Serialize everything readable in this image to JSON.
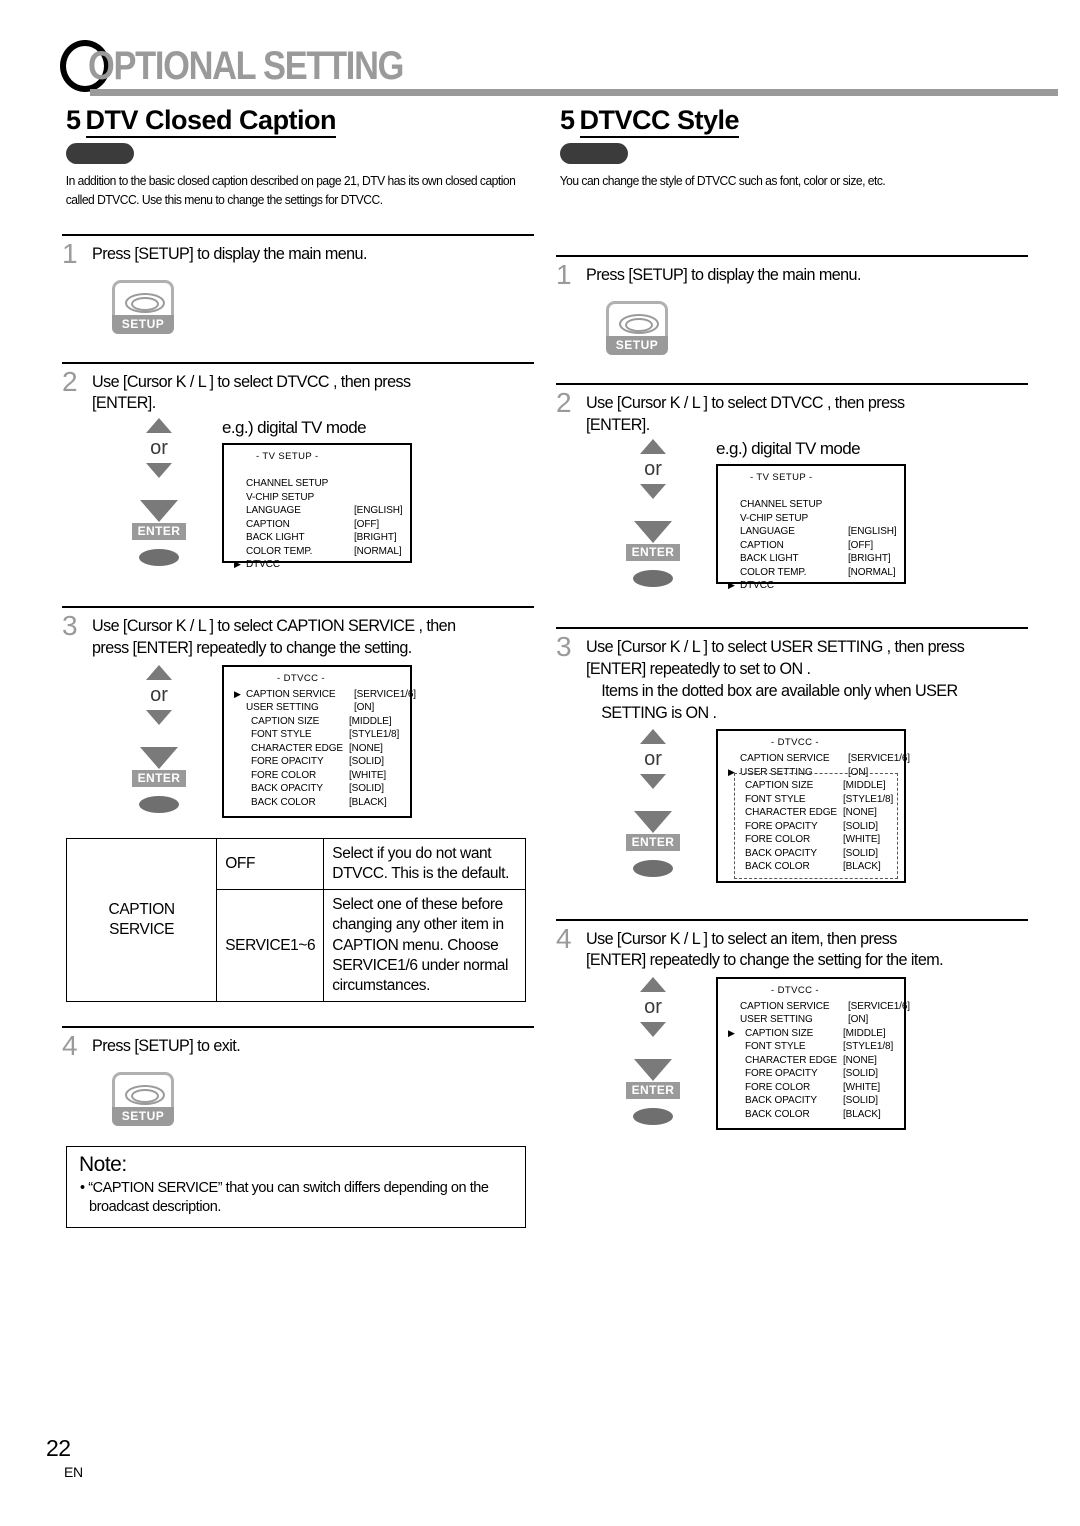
{
  "page": {
    "header_title": "OPTIONAL SETTING",
    "footer_number": "22",
    "footer_lang": "EN"
  },
  "columns": {
    "left": {
      "section_number": "5",
      "section_title": "DTV Closed Caption",
      "description": "In addition to the basic closed caption described on page 21, DTV has its own closed caption called DTVCC. Use this menu to change the settings for DTVCC.",
      "steps": {
        "s1": {
          "num": "1",
          "text": "Press [SETUP] to display the main menu."
        },
        "s2": {
          "num": "2",
          "line1": "Use [Cursor K / L ] to select  DTVCC , then press",
          "line2": "[ENTER].",
          "eg_label": "e.g.) digital TV mode"
        },
        "s3": {
          "num": "3",
          "line1": "Use [Cursor K / L ] to select  CAPTION SERVICE , then",
          "line2": "press [ENTER] repeatedly to change the setting."
        },
        "s4": {
          "num": "4",
          "text": "Press [SETUP] to exit."
        }
      },
      "keypad": {
        "or": "or",
        "enter": "ENTER"
      },
      "setup_key_label": "SETUP",
      "osd_tv_setup": {
        "title": "-  TV SETUP  -",
        "rows": [
          {
            "caret": "",
            "label": "CHANNEL SETUP",
            "value": ""
          },
          {
            "caret": "",
            "label": "V-CHIP  SETUP",
            "value": ""
          },
          {
            "caret": "",
            "label": "LANGUAGE",
            "value": "[ENGLISH]"
          },
          {
            "caret": "",
            "label": "CAPTION",
            "value": "[OFF]"
          },
          {
            "caret": "",
            "label": "BACK  LIGHT",
            "value": "[BRIGHT]"
          },
          {
            "caret": "",
            "label": "COLOR  TEMP.",
            "value": "[NORMAL]"
          },
          {
            "caret": "▶",
            "label": "DTVCC",
            "value": ""
          }
        ]
      },
      "osd_dtvcc": {
        "title": "- DTVCC -",
        "rows": [
          {
            "caret": "▶",
            "label": "CAPTION SERVICE",
            "value": "[SERVICE1/6]"
          },
          {
            "caret": "",
            "label": "USER SETTING",
            "value": "[ON]"
          },
          {
            "caret": "",
            "label": "CAPTION SIZE",
            "value": "[MIDDLE]"
          },
          {
            "caret": "",
            "label": "FONT STYLE",
            "value": "[STYLE1/8]"
          },
          {
            "caret": "",
            "label": "CHARACTER EDGE",
            "value": "[NONE]"
          },
          {
            "caret": "",
            "label": "FORE OPACITY",
            "value": "[SOLID]"
          },
          {
            "caret": "",
            "label": "FORE COLOR",
            "value": "[WHITE]"
          },
          {
            "caret": "",
            "label": "BACK OPACITY",
            "value": "[SOLID]"
          },
          {
            "caret": "",
            "label": "BACK COLOR",
            "value": "[BLACK]"
          }
        ]
      },
      "table": {
        "name": "CAPTION SERVICE",
        "rows": [
          {
            "value": "OFF",
            "desc": "Select if you do not want DTVCC. This is the default."
          },
          {
            "value": "SERVICE1~6",
            "desc": "Select one of these before changing any other item in  CAPTION  menu. Choose  SERVICE1/6  under normal circumstances."
          }
        ]
      },
      "note": {
        "title": "Note:",
        "item": "• “CAPTION SERVICE” that you can switch differs depending on the broadcast description."
      }
    },
    "right": {
      "section_number": "5",
      "section_title": "DTVCC Style",
      "description": "You can change the style of DTVCC such as font, color or size, etc.",
      "steps": {
        "s1": {
          "num": "1",
          "text": "Press [SETUP] to display the main menu."
        },
        "s2": {
          "num": "2",
          "line1": "Use [Cursor K / L ] to select  DTVCC , then press",
          "line2": "[ENTER].",
          "eg_label": "e.g.) digital TV mode"
        },
        "s3": {
          "num": "3",
          "line1": "Use [Cursor K / L ] to select  USER SETTING , then press",
          "line2": "[ENTER] repeatedly to set to  ON .",
          "line3": "Items in the dotted box are available only when  USER",
          "line4": "SETTING  is  ON ."
        },
        "s4": {
          "num": "4",
          "line1": "Use [Cursor K / L ] to select an item, then press",
          "line2": "[ENTER] repeatedly to change the setting for the item."
        }
      },
      "keypad": {
        "or": "or",
        "enter": "ENTER"
      },
      "setup_key_label": "SETUP",
      "osd_tv_setup": {
        "title": "-  TV SETUP  -",
        "rows": [
          {
            "caret": "",
            "label": "CHANNEL SETUP",
            "value": ""
          },
          {
            "caret": "",
            "label": "V-CHIP  SETUP",
            "value": ""
          },
          {
            "caret": "",
            "label": "LANGUAGE",
            "value": "[ENGLISH]"
          },
          {
            "caret": "",
            "label": "CAPTION",
            "value": "[OFF]"
          },
          {
            "caret": "",
            "label": "BACK  LIGHT",
            "value": "[BRIGHT]"
          },
          {
            "caret": "",
            "label": "COLOR  TEMP.",
            "value": "[NORMAL]"
          },
          {
            "caret": "▶",
            "label": "DTVCC",
            "value": ""
          }
        ]
      },
      "osd_dtvcc_user": {
        "title": "- DTVCC -",
        "rows": [
          {
            "caret": "",
            "label": "CAPTION SERVICE",
            "value": "[SERVICE1/6]"
          },
          {
            "caret": "▶",
            "label": "USER SETTING",
            "value": "[ON]"
          },
          {
            "caret": "",
            "label": "CAPTION SIZE",
            "value": "[MIDDLE]"
          },
          {
            "caret": "",
            "label": "FONT STYLE",
            "value": "[STYLE1/8]"
          },
          {
            "caret": "",
            "label": "CHARACTER EDGE",
            "value": "[NONE]"
          },
          {
            "caret": "",
            "label": "FORE OPACITY",
            "value": "[SOLID]"
          },
          {
            "caret": "",
            "label": "FORE COLOR",
            "value": "[WHITE]"
          },
          {
            "caret": "",
            "label": "BACK OPACITY",
            "value": "[SOLID]"
          },
          {
            "caret": "",
            "label": "BACK COLOR",
            "value": "[BLACK]"
          }
        ]
      },
      "osd_dtvcc_item": {
        "title": "- DTVCC -",
        "rows": [
          {
            "caret": "",
            "label": "CAPTION SERVICE",
            "value": "[SERVICE1/6]"
          },
          {
            "caret": "",
            "label": "USER SETTING",
            "value": "[ON]"
          },
          {
            "caret": "▶",
            "label": "CAPTION SIZE",
            "value": "[MIDDLE]"
          },
          {
            "caret": "",
            "label": "FONT STYLE",
            "value": "[STYLE1/8]"
          },
          {
            "caret": "",
            "label": "CHARACTER EDGE",
            "value": "[NONE]"
          },
          {
            "caret": "",
            "label": "FORE OPACITY",
            "value": "[SOLID]"
          },
          {
            "caret": "",
            "label": "FORE COLOR",
            "value": "[WHITE]"
          },
          {
            "caret": "",
            "label": "BACK OPACITY",
            "value": "[SOLID]"
          },
          {
            "caret": "",
            "label": "BACK COLOR",
            "value": "[BLACK]"
          }
        ]
      }
    }
  }
}
